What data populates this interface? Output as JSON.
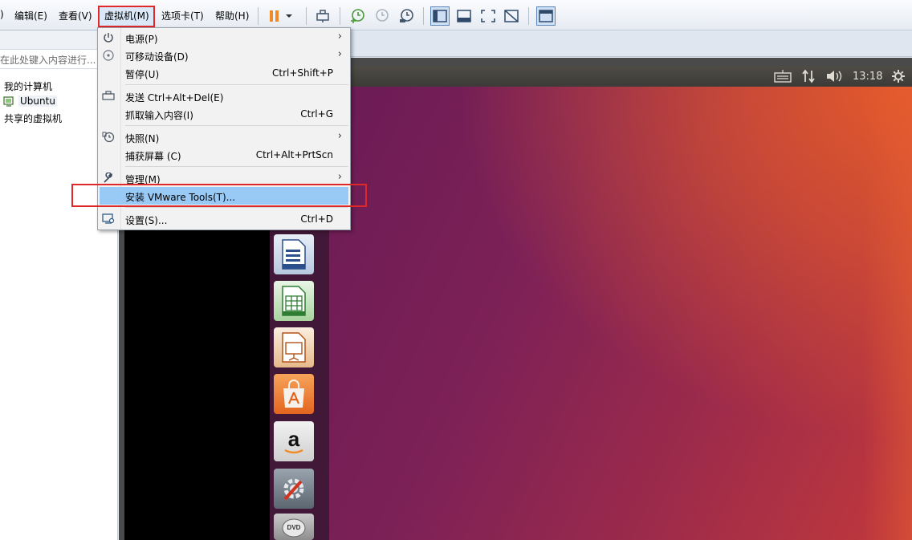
{
  "menubar": {
    "items": [
      {
        "label": "编辑(E)"
      },
      {
        "label": "查看(V)"
      },
      {
        "label": "虚拟机(M)"
      },
      {
        "label": "选项卡(T)"
      },
      {
        "label": "帮助(H)"
      }
    ]
  },
  "library": {
    "search_placeholder": "在此处键入内容进行...",
    "tree": {
      "root": "我的计算机",
      "vm": "Ubuntu",
      "shared": "共享的虚拟机"
    }
  },
  "ubuntu": {
    "clock": "13:18"
  },
  "vm_menu": {
    "items": [
      {
        "label": "电源(P)",
        "shortcut": "",
        "submenu": true,
        "icon": "power-icon"
      },
      {
        "label": "可移动设备(D)",
        "shortcut": "",
        "submenu": true,
        "icon": "disc-icon"
      },
      {
        "label": "暂停(U)",
        "shortcut": "Ctrl+Shift+P",
        "submenu": false,
        "icon": ""
      },
      {
        "label": "发送 Ctrl+Alt+Del(E)",
        "shortcut": "",
        "submenu": false,
        "icon": "send-keys-icon"
      },
      {
        "label": "抓取输入内容(I)",
        "shortcut": "Ctrl+G",
        "submenu": false,
        "icon": ""
      },
      {
        "label": "快照(N)",
        "shortcut": "",
        "submenu": true,
        "icon": "snapshot-icon"
      },
      {
        "label": "捕获屏幕 (C)",
        "shortcut": "Ctrl+Alt+PrtScn",
        "submenu": false,
        "icon": ""
      },
      {
        "label": "管理(M)",
        "shortcut": "",
        "submenu": true,
        "icon": "wrench-icon"
      },
      {
        "label": "安装 VMware Tools(T)...",
        "shortcut": "",
        "submenu": false,
        "icon": ""
      },
      {
        "label": "设置(S)...",
        "shortcut": "Ctrl+D",
        "submenu": false,
        "icon": "settings-icon"
      }
    ]
  },
  "colors": {
    "highlight": "#99c9f5",
    "annotation_red": "#e0282a",
    "ubuntu_launcher": "#41143a",
    "pause_orange": "#f08a24"
  }
}
